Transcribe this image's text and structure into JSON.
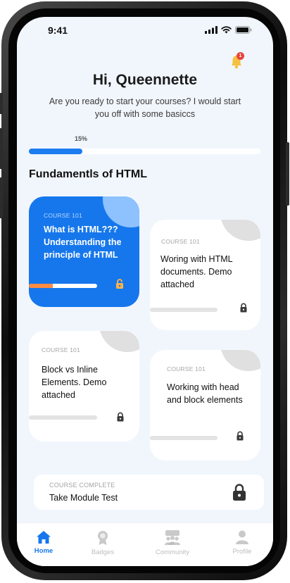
{
  "status_bar": {
    "time": "9:41"
  },
  "notifications": {
    "count": "1"
  },
  "header": {
    "greeting": "Hi, Queennette",
    "subtitle": "Are you ready to start your courses? I would start you off with some basiccs"
  },
  "progress": {
    "label": "15%",
    "value": 0.23
  },
  "section_title": "Fundamentls of HTML",
  "courses": [
    {
      "kicker": "COURSE 101",
      "title": "What is HTML??? Understanding the principle of HTML",
      "progress": 0.35,
      "locked": false
    },
    {
      "kicker": "COURSE 101",
      "title": "Woring with HTML documents. Demo attached",
      "progress": 0,
      "locked": true
    },
    {
      "kicker": "COURSE 101",
      "title": "Block vs Inline Elements. Demo attached",
      "progress": 0,
      "locked": true
    },
    {
      "kicker": "COURSE 101",
      "title": "Working with head and block elements",
      "progress": 0,
      "locked": true
    }
  ],
  "module_test": {
    "kicker": "COURSE COMPLETE",
    "title": "Take Module Test"
  },
  "nav": [
    {
      "label": "Home",
      "icon": "home-icon",
      "active": true
    },
    {
      "label": "Badges",
      "icon": "badge-icon",
      "active": false
    },
    {
      "label": "Community",
      "icon": "community-icon",
      "active": false
    },
    {
      "label": "Profile",
      "icon": "profile-icon",
      "active": false
    }
  ],
  "colors": {
    "accent": "#1677ec",
    "progress_orange": "#ff8c42",
    "background": "#f1f6fd",
    "bell": "#f6c142",
    "badge": "#e8423b"
  }
}
